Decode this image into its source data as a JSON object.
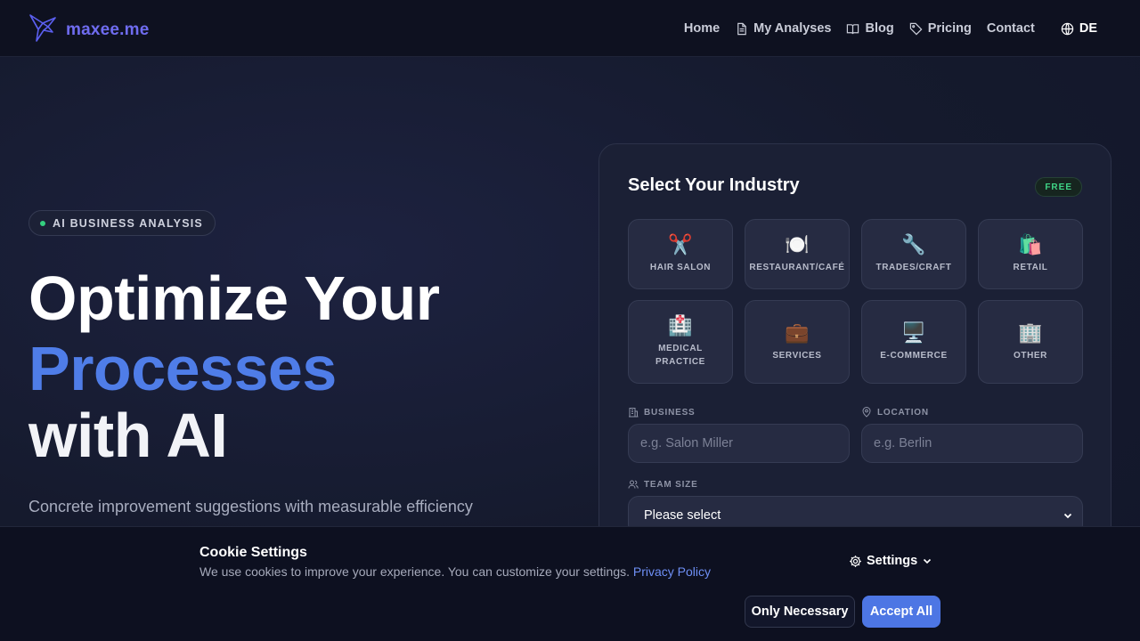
{
  "brand": {
    "name": "maxee.me",
    "accent": "#6f6cf0"
  },
  "nav": {
    "items": [
      {
        "label": "Home",
        "icon": ""
      },
      {
        "label": "My Analyses",
        "icon": "document-icon"
      },
      {
        "label": "Blog",
        "icon": "book-icon"
      },
      {
        "label": "Pricing",
        "icon": "tag-icon"
      },
      {
        "label": "Contact",
        "icon": ""
      }
    ],
    "language": "DE"
  },
  "hero": {
    "badge": "AI BUSINESS ANALYSIS",
    "line1": "Optimize Your",
    "line2": "Processes",
    "line3": "with AI",
    "subtitle": "Concrete improvement suggestions with measurable efficiency"
  },
  "industry_card": {
    "title": "Select Your Industry",
    "badge": "FREE",
    "industries": [
      {
        "label": "HAIR SALON",
        "icon": "✂️"
      },
      {
        "label": "RESTAURANT/CAFÉ",
        "icon": "🍽️"
      },
      {
        "label": "TRADES/CRAFT",
        "icon": "🔧"
      },
      {
        "label": "RETAIL",
        "icon": "🛍️"
      },
      {
        "label": "MEDICAL PRACTICE",
        "icon": "🏥"
      },
      {
        "label": "SERVICES",
        "icon": "💼"
      },
      {
        "label": "E-COMMERCE",
        "icon": "🖥️"
      },
      {
        "label": "OTHER",
        "icon": "🏢"
      }
    ],
    "business": {
      "label": "BUSINESS",
      "placeholder": "e.g. Salon Miller"
    },
    "location": {
      "label": "LOCATION",
      "placeholder": "e.g. Berlin"
    },
    "team_size": {
      "label": "TEAM SIZE",
      "value": "Please select"
    }
  },
  "cookie": {
    "title": "Cookie Settings",
    "text": "We use cookies to improve your experience. You can customize your settings.",
    "link": "Privacy Policy",
    "settings": "Settings",
    "only_necessary": "Only Necessary",
    "accept_all": "Accept All"
  }
}
